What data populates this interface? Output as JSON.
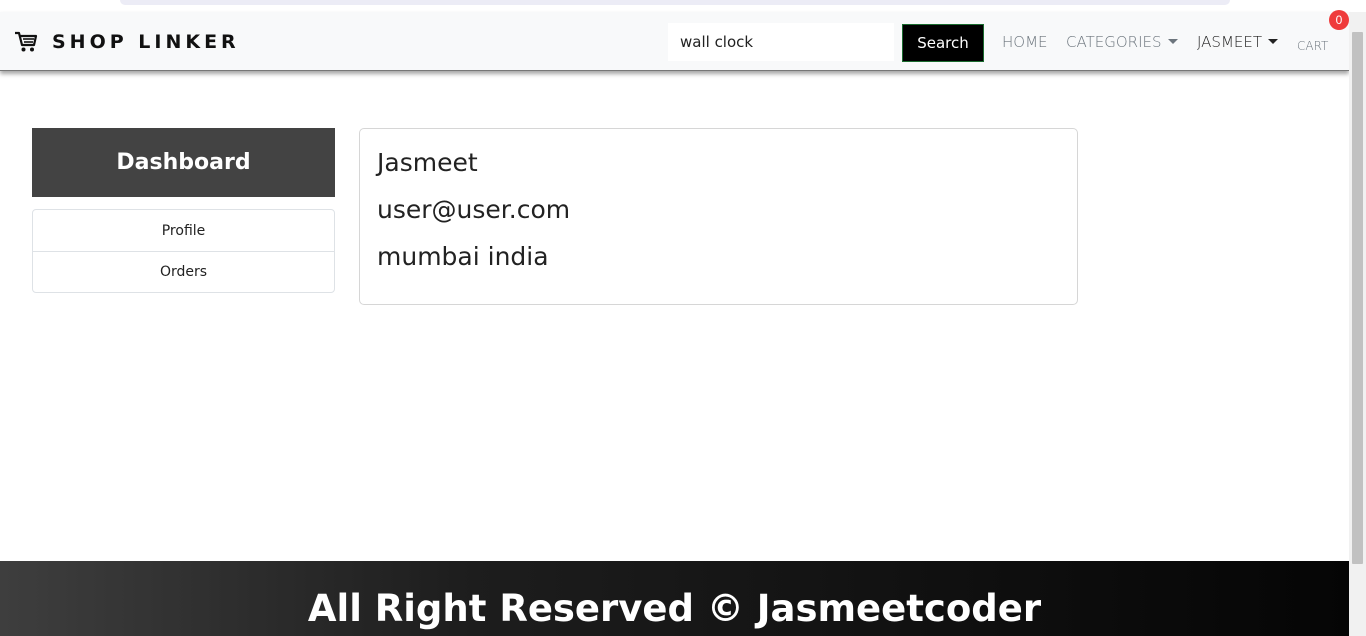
{
  "navbar": {
    "brand": "SHOP LINKER",
    "brand_icon": "shopping-cart-icon",
    "search": {
      "value": "wall clock",
      "button": "Search"
    },
    "links": {
      "home": "HOME",
      "categories": "CATEGORIES",
      "user": "JASMEET",
      "cart": "CART"
    },
    "cart_count": "0",
    "badge_color": "#ef3b3b"
  },
  "sidebar": {
    "title": "Dashboard",
    "items": [
      "Profile",
      "Orders"
    ]
  },
  "profile": {
    "name": "Jasmeet",
    "email": "user@user.com",
    "address": "mumbai india"
  },
  "footer": {
    "text": "All Right Reserved © Jasmeetcoder"
  }
}
